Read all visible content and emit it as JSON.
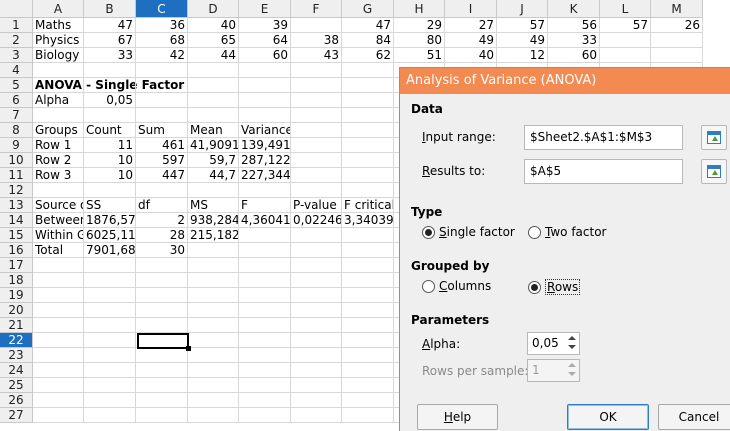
{
  "columns": [
    "A",
    "B",
    "C",
    "D",
    "E",
    "F",
    "G",
    "H",
    "I",
    "J",
    "K",
    "L",
    "M"
  ],
  "selected_column": "C",
  "rows": [
    "1",
    "2",
    "3",
    "4",
    "5",
    "6",
    "7",
    "8",
    "9",
    "10",
    "11",
    "12",
    "13",
    "14",
    "15",
    "16",
    "17",
    "18",
    "19",
    "20",
    "21",
    "22",
    "23",
    "24",
    "25",
    "26",
    "27"
  ],
  "selected_row": "22",
  "cells": {
    "A1": "Maths",
    "B1": "47",
    "C1": "36",
    "D1": "40",
    "E1": "39",
    "G1": "47",
    "H1": "29",
    "I1": "27",
    "J1": "57",
    "K1": "56",
    "L1": "57",
    "M1": "26",
    "A2": "Physics",
    "B2": "67",
    "C2": "68",
    "D2": "65",
    "E2": "64",
    "F2": "38",
    "G2": "84",
    "H2": "80",
    "I2": "49",
    "J2": "49",
    "K2": "33",
    "A3": "Biology",
    "B3": "33",
    "C3": "42",
    "D3": "44",
    "E3": "60",
    "F3": "43",
    "G3": "62",
    "H3": "51",
    "I3": "40",
    "J3": "12",
    "K3": "60",
    "A5": "ANOVA - Single Factor",
    "A6": "Alpha",
    "B6": "0,05",
    "A8": "Groups",
    "B8": "Count",
    "C8": "Sum",
    "D8": "Mean",
    "E8": "Variance",
    "A9": "Row 1",
    "B9": "11",
    "C9": "461",
    "D9": "41,9091",
    "E9": "139,491",
    "A10": "Row 2",
    "B10": "10",
    "C10": "597",
    "D10": "59,7",
    "E10": "287,122",
    "A11": "Row 3",
    "B11": "10",
    "C11": "447",
    "D11": "44,7",
    "E11": "227,344",
    "A13": "Source of Variation",
    "B13": "SS",
    "C13": "df",
    "D13": "MS",
    "E13": "F",
    "F13": "P-value",
    "G13": "F critical",
    "A14": "Between Groups",
    "B14": "1876,57",
    "C14": "2",
    "D14": "938,284",
    "E14": "4,36041",
    "F14": "0,02246",
    "G14": "3,34039",
    "A15": "Within Groups",
    "B15": "6025,11",
    "C15": "28",
    "D15": "215,182",
    "A16": "Total",
    "B16": "7901,68",
    "C16": "30"
  },
  "dialog": {
    "title": "Analysis of Variance (ANOVA)",
    "data_heading": "Data",
    "input_range_label": "Input range:",
    "input_range_value": "$Sheet2.$A$1:$M$3",
    "results_to_label": "Results to:",
    "results_to_value": "$A$5",
    "type_heading": "Type",
    "single_factor_label": "Single factor",
    "two_factor_label": "Two factor",
    "type_selected": "Single factor",
    "grouped_by_heading": "Grouped by",
    "columns_label": "Columns",
    "rows_label": "Rows",
    "grouped_selected": "Rows",
    "parameters_heading": "Parameters",
    "alpha_label": "Alpha:",
    "alpha_value": "0,05",
    "rows_per_sample_label": "Rows per sample:",
    "rows_per_sample_value": "1",
    "help_label": "Help",
    "ok_label": "OK",
    "cancel_label": "Cancel"
  },
  "colors": {
    "titlebar": "#f28a52",
    "selection_header": "#1e6fbf",
    "dialog_bg": "#efefef"
  }
}
